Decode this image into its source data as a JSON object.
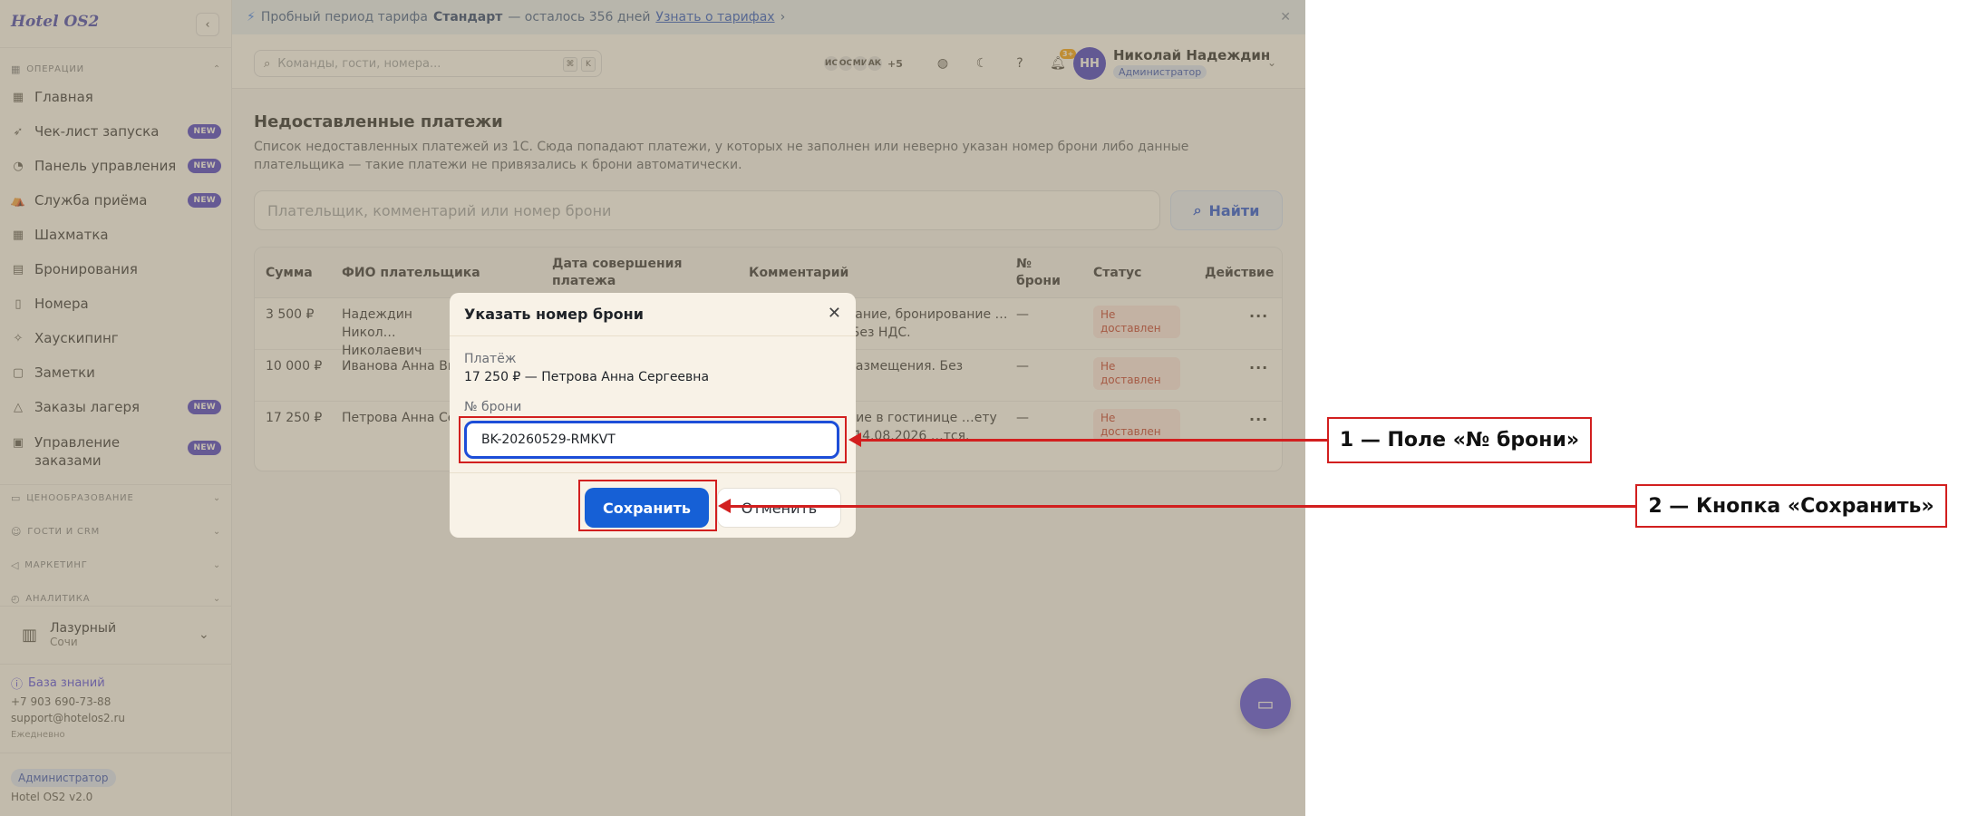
{
  "app": {
    "logo": "Hotel OS2"
  },
  "trial": {
    "prefix": "Пробный период тарифа",
    "plan": "Стандарт",
    "suffix": "— осталось 356 дней",
    "link": "Узнать о тарифах",
    "link_arrow": "›",
    "close": "✕"
  },
  "search": {
    "placeholder": "Команды, гости, номера...",
    "kbd1": "⌘",
    "kbd2": "K"
  },
  "presence": {
    "users": [
      "ИС",
      "ОС",
      "МИ",
      "АК"
    ],
    "more": "+5"
  },
  "notifications": {
    "count": "3+"
  },
  "user": {
    "initials": "НН",
    "name": "Николай Надеждин",
    "role": "Администратор"
  },
  "sidebar": {
    "section_ops": "ОПЕРАЦИИ",
    "items": [
      {
        "label": "Главная",
        "badge": ""
      },
      {
        "label": "Чек-лист запуска",
        "badge": "NEW"
      },
      {
        "label": "Панель управления",
        "badge": "NEW"
      },
      {
        "label": "Служба приёма",
        "badge": "NEW"
      },
      {
        "label": "Шахматка",
        "badge": ""
      },
      {
        "label": "Бронирования",
        "badge": ""
      },
      {
        "label": "Номера",
        "badge": ""
      },
      {
        "label": "Хаускипинг",
        "badge": ""
      },
      {
        "label": "Заметки",
        "badge": ""
      },
      {
        "label": "Заказы лагеря",
        "badge": "NEW"
      },
      {
        "label": "Управление заказами",
        "badge": "NEW"
      }
    ],
    "sections_collapsed": [
      "ЦЕНООБРАЗОВАНИЕ",
      "ГОСТИ И CRM",
      "МАРКЕТИНГ",
      "АНАЛИТИКА"
    ],
    "hotel": {
      "name": "Лазурный",
      "city": "Сочи"
    },
    "kb_link": "База знаний",
    "phone": "+7 903 690-73-88",
    "email": "support@hotelos2.ru",
    "hours": "Ежедневно",
    "role": "Администратор",
    "version": "Hotel OS2 v2.0"
  },
  "page": {
    "title": "Недоставленные платежи",
    "description": "Список недоставленных платежей из 1С. Сюда попадают платежи, у которых не заполнен или неверно указан номер брони либо данные плательщика — такие платежи не привязались к брони автоматически.",
    "filter_placeholder": "Плательщик, комментарий или номер брони",
    "find_button": "Найти"
  },
  "table": {
    "headers": {
      "amount": "Сумма",
      "payer": "ФИО плательщика",
      "date": "Дата совершения платежа",
      "comment": "Комментарий",
      "booking": "№ брони",
      "status": "Статус",
      "action": "Действие"
    },
    "rows": [
      {
        "amount": "3 500 ₽",
        "payer": "Надеждин Никол… Николаевич",
        "comment": "…вание, бронирование …4. Без НДС.",
        "booking": "—",
        "status": "Не доставлен"
      },
      {
        "amount": "10 000 ₽",
        "payer": "Иванова Анна Ви…",
        "comment": "…размещения. Без",
        "booking": "—",
        "status": "Не доставлен"
      },
      {
        "amount": "17 250 ₽",
        "payer": "Петрова Анна Се…",
        "comment": "…ние в гостинице …ету от 14.08.2026 …тся.",
        "booking": "—",
        "status": "Не доставлен"
      }
    ],
    "action_icon": "···"
  },
  "modal": {
    "title": "Указать номер брони",
    "close": "✕",
    "payment_label": "Платёж",
    "payment_value": "17 250 ₽ — Петрова Анна Сергеевна",
    "booking_label": "№ брони",
    "booking_value": "BK-20260529-RMKVT",
    "save": "Сохранить",
    "cancel": "Отменить"
  },
  "annotations": {
    "callout1": "1 — Поле «№ брони»",
    "callout2": "2 — Кнопка «Сохранить»",
    "color": "#d21f1f"
  }
}
